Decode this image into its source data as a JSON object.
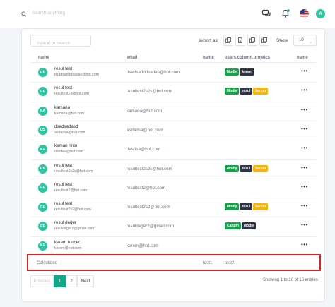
{
  "topbar": {
    "search_placeholder": "Search anything",
    "avatar_initial": "A"
  },
  "toolbar": {
    "search_placeholder": "Type in to Search",
    "export_label": "export as:",
    "show_label": "Show",
    "page_size": "10"
  },
  "table": {
    "headers": [
      "name",
      "email",
      "name",
      "users.column.projetcs",
      "name"
    ],
    "rows": [
      {
        "initials": "RE",
        "name": "resul test",
        "sub_email": "dsadsadddsadas@hot.com",
        "email": "dsadsadddsadas@hot.com",
        "projects": [
          "Modly",
          "kerem"
        ]
      },
      {
        "initials": "RE",
        "name": "resul test",
        "sub_email": "resultest2s@hot.com",
        "email": "resultest2s2s@hot.com",
        "projects": [
          "Modly",
          "resul",
          "kerem"
        ]
      },
      {
        "initials": "KA",
        "name": "kamana",
        "sub_email": "kamana@hot.com",
        "email": "kamana@hot.com",
        "projects": []
      },
      {
        "initials": "DS",
        "name": "dsadsadasd",
        "sub_email": "asdadsa@hot.com",
        "email": "asdadsa@hot.com",
        "projects": []
      },
      {
        "initials": "KE",
        "name": "keman nntn",
        "sub_email": "dasdea@hot.com",
        "email": "dasdsa@hot.com",
        "projects": []
      },
      {
        "initials": "RE",
        "name": "resul test",
        "sub_email": "resultest2s2s@hot.com",
        "email": "resultest2s2s@hot.com",
        "projects": [
          "Modly",
          "resul",
          "kerem"
        ]
      },
      {
        "initials": "RE",
        "name": "resul test",
        "sub_email": "resultest2@hot.com",
        "email": "resultest2@hot.com",
        "projects": []
      },
      {
        "initials": "RE",
        "name": "resul test",
        "sub_email": "resultest2s2@hot.com",
        "email": "resultest2s2@hot.com",
        "projects": [
          "Modly",
          "resul",
          "kerem"
        ]
      },
      {
        "initials": "RE",
        "name": "resul değer",
        "sub_email": "resuldeger2@gmail.com",
        "email": "resuldeger2@gmail.com",
        "projects": [
          "Canpin",
          "Modly"
        ]
      },
      {
        "initials": "KE",
        "name": "kerem tuncer",
        "sub_email": "kerem@hot.com",
        "email": "kerem@hot.com",
        "projects": []
      }
    ],
    "row_action": "•••",
    "calculated": {
      "label": "Calculated",
      "test1": "test1",
      "test2": "test2"
    }
  },
  "pagination": {
    "prev": "Previous",
    "pages": [
      "1",
      "2"
    ],
    "next": "Next",
    "entries": "Showing 1 to 10 of 16 entries"
  },
  "colors": {
    "accent": "#17a589",
    "avatar": "#2ec4a0",
    "pill_green": "#16a34a",
    "pill_dark": "#2f3542",
    "pill_amber": "#f5b312",
    "highlight": "#d2242b"
  }
}
